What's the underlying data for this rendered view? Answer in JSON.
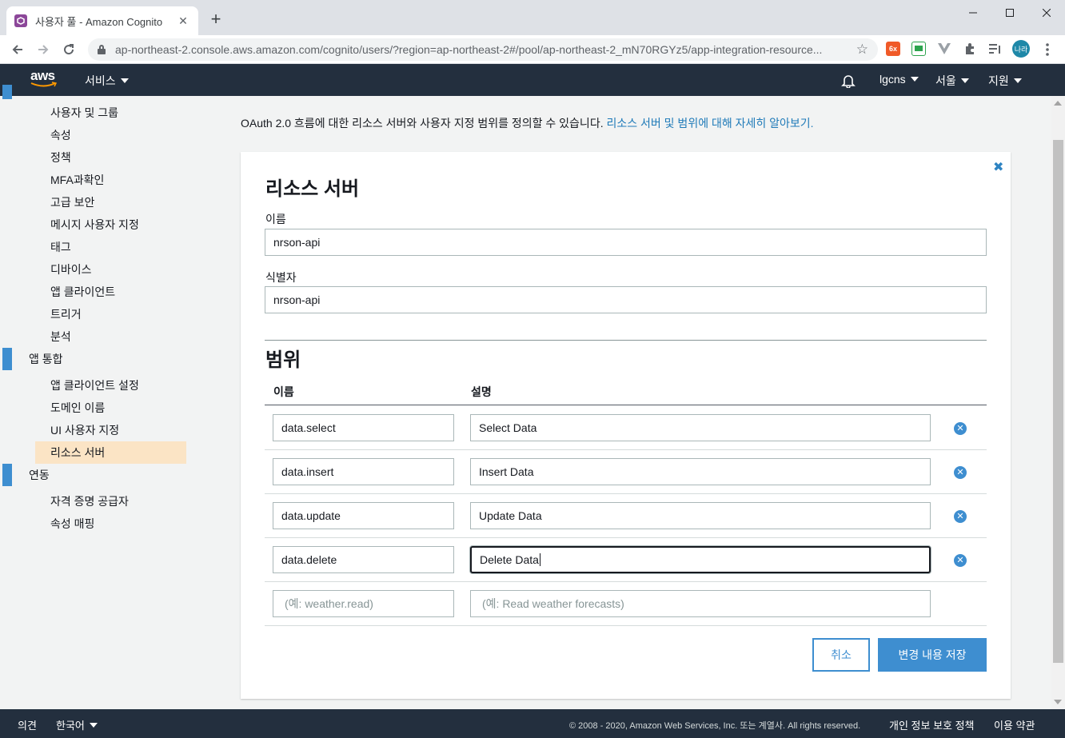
{
  "browser": {
    "tab_title": "사용자 풀 - Amazon Cognito",
    "tab_close": "✕",
    "new_tab": "+",
    "url_host": "ap-northeast-2.console.aws.amazon.com",
    "url_path": "/cognito/users/?region=ap-northeast-2#/pool/ap-northeast-2_mN70RGYz5/app-integration-resource...",
    "profile_initials": "나라",
    "ext_badge": "6x"
  },
  "aws": {
    "logo": "aws",
    "services_label": "서비스",
    "account": "lgcns",
    "region": "서울",
    "support": "지원"
  },
  "sidebar": {
    "items_top": [
      "사용자 및 그룹",
      "속성",
      "정책",
      "MFA과확인",
      "고급 보안",
      "메시지 사용자 지정",
      "태그",
      "디바이스",
      "앱 클라이언트",
      "트리거",
      "분석"
    ],
    "section_app": "앱 통합",
    "items_app": [
      "앱 클라이언트 설정",
      "도메인 이름",
      "UI 사용자 지정",
      "리소스 서버"
    ],
    "section_fed": "연동",
    "items_fed": [
      "자격 증명 공급자",
      "속성 매핑"
    ]
  },
  "page": {
    "intro_text": "OAuth 2.0 흐름에 대한 리소스 서버와 사용자 지정 범위를 정의할 수 있습니다.",
    "intro_link": "리소스 서버 및 범위에 대해 자세히 알아보기."
  },
  "form": {
    "heading": "리소스 서버",
    "name_label": "이름",
    "name_value": "nrson-api",
    "identifier_label": "식별자",
    "identifier_value": "nrson-api",
    "scopes_heading": "범위",
    "col_name": "이름",
    "col_desc": "설명",
    "scopes": [
      {
        "name": "data.select",
        "desc": "Select Data"
      },
      {
        "name": "data.insert",
        "desc": "Insert Data"
      },
      {
        "name": "data.update",
        "desc": "Update Data"
      },
      {
        "name": "data.delete",
        "desc": "Delete Data"
      }
    ],
    "new_name_placeholder": "(예: weather.read)",
    "new_desc_placeholder": "(예:  Read weather forecasts)",
    "cancel_label": "취소",
    "save_label": "변경 내용 저장"
  },
  "footer": {
    "feedback": "의견",
    "language": "한국어",
    "copyright": "© 2008 - 2020, Amazon Web Services, Inc. 또는 계열사. All rights reserved.",
    "privacy": "개인 정보 보호 정책",
    "terms": "이용 약관"
  },
  "colors": {
    "aws_header": "#232f3e",
    "accent_blue": "#3e8ed0",
    "active_nav": "#fbe4c5"
  }
}
